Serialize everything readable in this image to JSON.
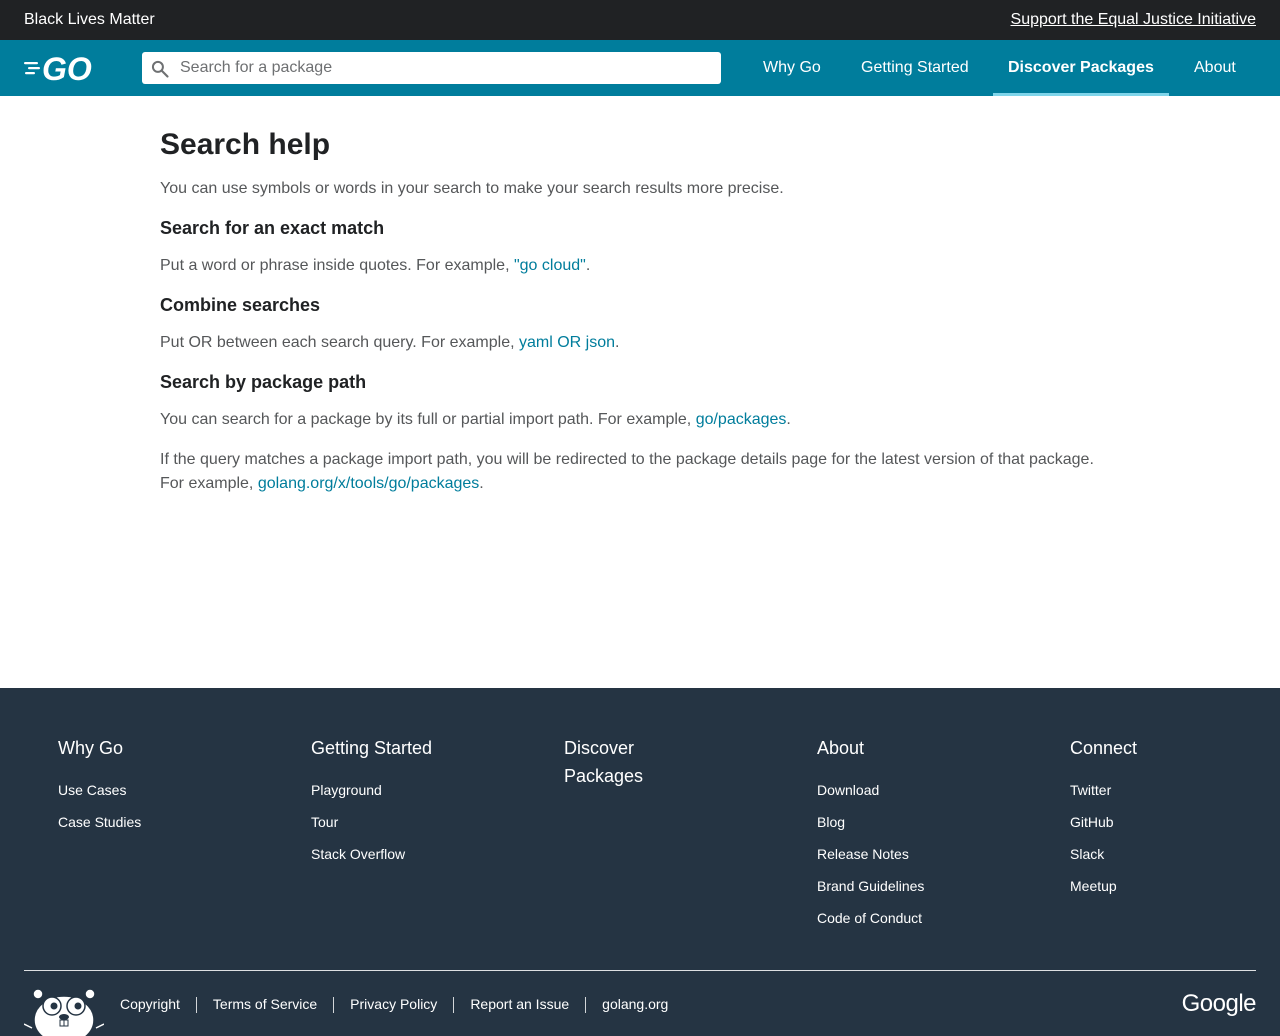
{
  "banner": {
    "message": "Black Lives Matter",
    "link": "Support the Equal Justice Initiative"
  },
  "header": {
    "logo": "GO",
    "search_placeholder": "Search for a package",
    "nav": [
      "Why Go",
      "Getting Started",
      "Discover Packages",
      "About"
    ],
    "active_nav": "Discover Packages"
  },
  "content": {
    "title": "Search help",
    "intro": "You can use symbols or words in your search to make your search results more precise.",
    "exact": {
      "heading": "Search for an exact match",
      "text": "Put a word or phrase inside quotes. For example, ",
      "example": "\"go cloud\"",
      "end": "."
    },
    "combine": {
      "heading": "Combine searches",
      "text": "Put OR between each search query. For example, ",
      "example": "yaml OR json",
      "end": "."
    },
    "path": {
      "heading": "Search by package path",
      "text": "You can search for a package by its full or partial import path. For example, ",
      "example": "go/packages",
      "end": ".",
      "redirect_line1": "If the query matches a package import path, you will be redirected to the package details page for the latest version of that package.",
      "redirect_text": "For example, ",
      "redirect_example": "golang.org/x/tools/go/packages",
      "redirect_end": "."
    }
  },
  "footer": {
    "columns": [
      {
        "heading": "Why Go",
        "links": [
          "Use Cases",
          "Case Studies"
        ]
      },
      {
        "heading": "Getting Started",
        "links": [
          "Playground",
          "Tour",
          "Stack Overflow"
        ]
      },
      {
        "heading": "Discover Packages",
        "links": []
      },
      {
        "heading": "About",
        "links": [
          "Download",
          "Blog",
          "Release Notes",
          "Brand Guidelines",
          "Code of Conduct"
        ]
      },
      {
        "heading": "Connect",
        "links": [
          "Twitter",
          "GitHub",
          "Slack",
          "Meetup"
        ]
      }
    ],
    "bottom_links": [
      "Copyright",
      "Terms of Service",
      "Privacy Policy",
      "Report an Issue",
      "golang.org"
    ],
    "brand": "Google"
  }
}
